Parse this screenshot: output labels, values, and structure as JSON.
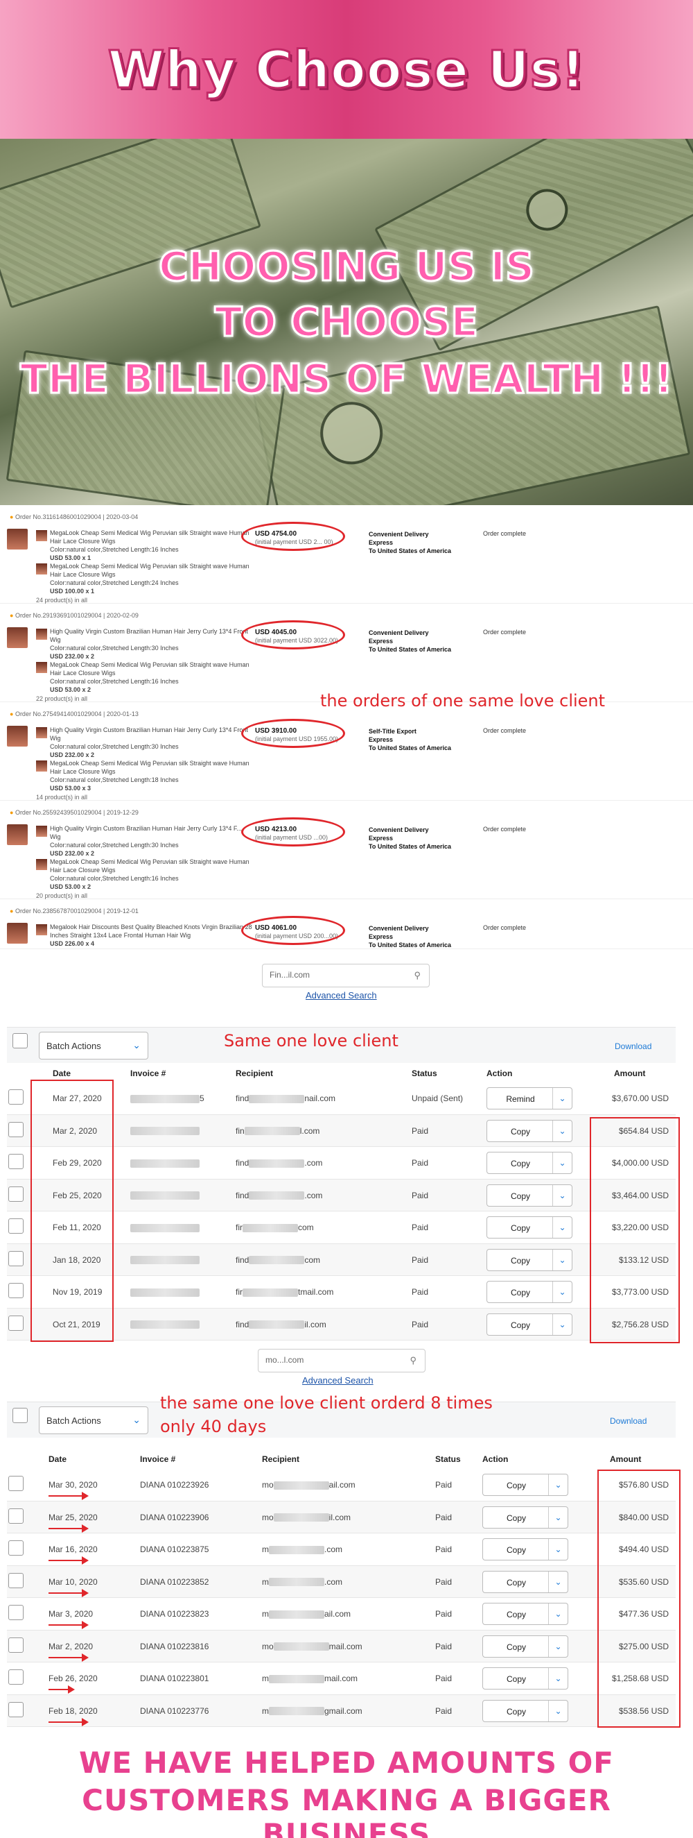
{
  "banner": {
    "title": "Why Choose Us!"
  },
  "hero": {
    "lines": [
      "CHOOSING US IS",
      "TO CHOOSE",
      "THE BILLIONS OF WEALTH !!!"
    ]
  },
  "orders": {
    "note": "the orders of one same love client",
    "items": [
      {
        "head": "Order No.3116148600102900​4  |  2020-03-04",
        "price": "USD 4754.00",
        "initial": "(initial payment USD 2... 00)",
        "ship": [
          "Convenient Delivery",
          "Express",
          "To United States of America"
        ],
        "status": "Order complete",
        "lines": [
          "MegaLook Cheap Semi Medical Wig Peruvian silk Straight wave Human",
          "Hair Lace Closure Wigs",
          "Color:natural color,Stretched Length:16 Inches",
          "USD 53.00 x 1",
          "MegaLook Cheap Semi Medical Wig Peruvian silk Straight wave Human",
          "Hair Lace Closure Wigs",
          "Color:natural color,Stretched Length:24 Inches",
          "USD 100.00 x 1"
        ],
        "count": "24 product(s) in all"
      },
      {
        "head": "Order No.2919369100102900​4  |  2020-02-09",
        "price": "USD 4045.00",
        "initial": "(initial payment USD 3022.00)",
        "ship": [
          "Convenient Delivery",
          "Express",
          "To United States of America"
        ],
        "status": "Order complete",
        "lines": [
          "High Quality Virgin Custom Brazilian Human Hair Jerry Curly 13*4 Front",
          "Wig",
          "Color:natural color,Stretched Length:30 Inches",
          "USD 232.00 x 2",
          "MegaLook Cheap Semi Medical Wig Peruvian silk Straight wave Human",
          "Hair Lace Closure Wigs",
          "Color:natural color,Stretched Length:16 Inches",
          "USD 53.00 x 2"
        ],
        "count": "22 product(s) in all"
      },
      {
        "head": "Order No.2754941400102900​4  |  2020-01-13",
        "price": "USD 3910.00",
        "initial": "(initial payment USD 1955.00)",
        "ship": [
          "Self-Title Export",
          "Express",
          "To United States of America"
        ],
        "status": "Order complete",
        "lines": [
          "High Quality Virgin Custom Brazilian Human Hair Jerry Curly 13*4 Front",
          "Wig",
          "Color:natural color,Stretched Length:30 Inches",
          "USD 232.00 x 2",
          "MegaLook Cheap Semi Medical Wig Peruvian silk Straight wave Human",
          "Hair Lace Closure Wigs",
          "Color:natural color,Stretched Length:18 Inches",
          "USD 53.00 x 3"
        ],
        "count": "14 product(s) in all"
      },
      {
        "head": "Order No.2559243950102900​4  |  2019-12-29",
        "price": "USD 4213.00",
        "initial": "(initial payment USD ...00)",
        "ship": [
          "Convenient Delivery",
          "Express",
          "To United States of America"
        ],
        "status": "Order complete",
        "lines": [
          "High Quality Virgin Custom Brazilian Human Hair Jerry Curly 13*4 F...",
          "Wig",
          "Color:natural color,Stretched Length:30 Inches",
          "USD 232.00 x 2",
          "MegaLook Cheap Semi Medical Wig Peruvian silk Straight wave Human",
          "Hair Lace Closure Wigs",
          "Color:natural color,Stretched Length:16 Inches",
          "USD 53.00 x 2"
        ],
        "count": "20 product(s) in all"
      },
      {
        "head": "Order No.2385678700102900​4  |  2019-12-01",
        "price": "USD 4061.00",
        "initial": "(initial payment USD 200...00)",
        "ship": [
          "Convenient Delivery",
          "Express",
          "To United States of America"
        ],
        "status": "Order complete",
        "lines": [
          "Megalook Hair Discounts Best Quality Bleached Knots Virgin Brazilian 28",
          "Inches Straight 13x4 Lace Frontal Human Hair Wig",
          "USD 226.00 x 4"
        ],
        "count": ""
      }
    ]
  },
  "search1": {
    "value": "Fin...il.com",
    "advanced": "Advanced Search"
  },
  "table1": {
    "note": "Same one love client",
    "batch": "Batch Actions",
    "download": "Download",
    "headers": [
      "Date",
      "Invoice #",
      "Recipient",
      "Status",
      "Action",
      "Amount"
    ],
    "rows": [
      {
        "date": "Mar 27, 2020",
        "inv_tail": "5",
        "recip_a": "find",
        "recip_b": "nail.com",
        "status": "Unpaid (Sent)",
        "action": "Remind",
        "amount": "$3,670.00 USD"
      },
      {
        "date": "Mar 2, 2020",
        "inv_tail": "",
        "recip_a": "fin",
        "recip_b": "l.com",
        "status": "Paid",
        "action": "Copy",
        "amount": "$654.84 USD"
      },
      {
        "date": "Feb 29, 2020",
        "inv_tail": "",
        "recip_a": "find",
        "recip_b": ".com",
        "status": "Paid",
        "action": "Copy",
        "amount": "$4,000.00 USD"
      },
      {
        "date": "Feb 25, 2020",
        "inv_tail": "",
        "recip_a": "find",
        "recip_b": ".com",
        "status": "Paid",
        "action": "Copy",
        "amount": "$3,464.00 USD"
      },
      {
        "date": "Feb 11, 2020",
        "inv_tail": "",
        "recip_a": "fir",
        "recip_b": "com",
        "status": "Paid",
        "action": "Copy",
        "amount": "$3,220.00 USD"
      },
      {
        "date": "Jan 18, 2020",
        "inv_tail": "",
        "recip_a": "find",
        "recip_b": "com",
        "status": "Paid",
        "action": "Copy",
        "amount": "$133.12 USD"
      },
      {
        "date": "Nov 19, 2019",
        "inv_tail": "",
        "recip_a": "fir",
        "recip_b": "tmail.com",
        "status": "Paid",
        "action": "Copy",
        "amount": "$3,773.00 USD"
      },
      {
        "date": "Oct 21, 2019",
        "inv_tail": "",
        "recip_a": "find",
        "recip_b": "il.com",
        "status": "Paid",
        "action": "Copy",
        "amount": "$2,756.28 USD"
      }
    ]
  },
  "search2": {
    "value": "mo...l.com",
    "advanced": "Advanced Search"
  },
  "table2": {
    "note_line1": "the same one love client orderd 8 times",
    "note_line2": "only 40 days",
    "batch": "Batch Actions",
    "download": "Download",
    "headers": [
      "Date",
      "Invoice #",
      "Recipient",
      "Status",
      "Action",
      "Amount"
    ],
    "rows": [
      {
        "date": "Mar 30, 2020",
        "inv": "DIANA 010223926",
        "recip_a": "mo",
        "recip_b": "ail.com",
        "status": "Paid",
        "action": "Copy",
        "amount": "$576.80 USD"
      },
      {
        "date": "Mar 25, 2020",
        "inv": "DIANA 010223906",
        "recip_a": "mo",
        "recip_b": "il.com",
        "status": "Paid",
        "action": "Copy",
        "amount": "$840.00 USD"
      },
      {
        "date": "Mar 16, 2020",
        "inv": "DIANA 010223875",
        "recip_a": "m",
        "recip_b": ".com",
        "status": "Paid",
        "action": "Copy",
        "amount": "$494.40 USD"
      },
      {
        "date": "Mar 10, 2020",
        "inv": "DIANA 010223852",
        "recip_a": "m",
        "recip_b": ".com",
        "status": "Paid",
        "action": "Copy",
        "amount": "$535.60 USD"
      },
      {
        "date": "Mar 3, 2020",
        "inv": "DIANA 010223823",
        "recip_a": "m",
        "recip_b": "ail.com",
        "status": "Paid",
        "action": "Copy",
        "amount": "$477.36 USD"
      },
      {
        "date": "Mar 2, 2020",
        "inv": "DIANA 010223816",
        "recip_a": "mo",
        "recip_b": "mail.com",
        "status": "Paid",
        "action": "Copy",
        "amount": "$275.00 USD"
      },
      {
        "date": "Feb 26, 2020",
        "inv": "DIANA 010223801",
        "recip_a": "m",
        "recip_b": "mail.com",
        "status": "Paid",
        "action": "Copy",
        "amount": "$1,258.68 USD"
      },
      {
        "date": "Feb 18, 2020",
        "inv": "DIANA 010223776",
        "recip_a": "m",
        "recip_b": "gmail.com",
        "status": "Paid",
        "action": "Copy",
        "amount": "$538.56 USD"
      }
    ]
  },
  "footer": {
    "line1": "WE HAVE HELPED AMOUNTS OF",
    "line2": "CUSTOMERS MAKING A BIGGER BUSINESS"
  },
  "colors": {
    "accent_pink": "#e8418f",
    "annotation_red": "#e0262b",
    "link_blue": "#1d54a8"
  }
}
